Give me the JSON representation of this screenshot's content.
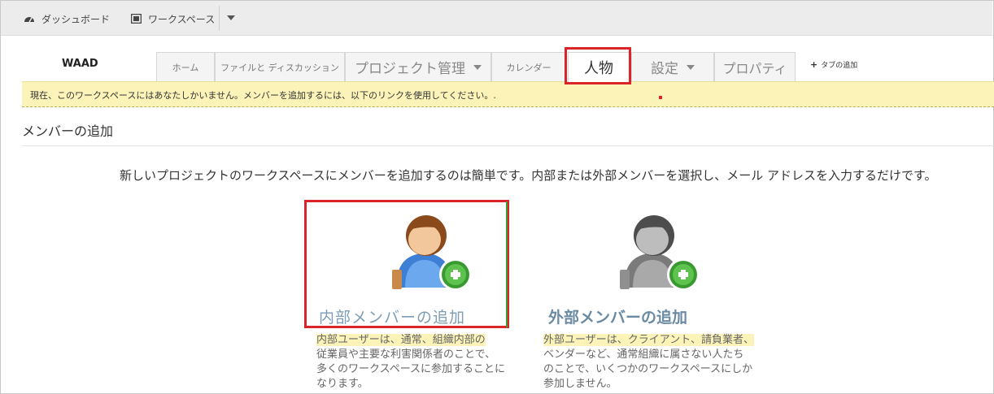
{
  "topbar": {
    "dashboard_label": "ダッシュボード",
    "workspace_label": "ワークスペース"
  },
  "workspace": {
    "name": "WAAD"
  },
  "tabs": [
    {
      "label": "ホーム"
    },
    {
      "label": "ファイルと ディスカッション"
    },
    {
      "label": "プロジェクト管理"
    },
    {
      "label": "カレンダー"
    },
    {
      "label": "人物"
    },
    {
      "label": "設定"
    },
    {
      "label": "プロパティ"
    }
  ],
  "add_tab_label": "タブの追加",
  "notice": "現在、このワークスペースにはあなたしかいません。メンバーを追加するには、以下のリンクを使用してください。.",
  "section_title": "メンバーの追加",
  "intro": "新しいプロジェクトのワークスペースにメンバーを追加するのは簡単です。内部または外部メンバーを選択し、メール アドレスを入力するだけです。",
  "internal": {
    "title": "内部メンバーの追加",
    "desc_lines": [
      "内部ユーザーは、通常、組織内部の",
      "従業員や主要な利害関係者のことで、",
      "多くのワークスペースに参加することに",
      "なります。"
    ]
  },
  "external": {
    "title": "外部メンバーの追加",
    "desc_lines": [
      "外部ユーザーは、クライアント、請負業者、",
      "ベンダーなど、通常組織に属さない人たち",
      "のことで、いくつかのワークスペースにしか",
      "参加しません。"
    ]
  },
  "colors": {
    "highlight_red": "#d9252a",
    "notice_bg": "#fbf3b8",
    "member_title": "#6d8fa8",
    "add_green": "#4caf3c"
  },
  "icons": [
    "dashboard-icon",
    "workspace-icon",
    "chevron-down-icon",
    "plus-icon",
    "user-add-icon"
  ]
}
